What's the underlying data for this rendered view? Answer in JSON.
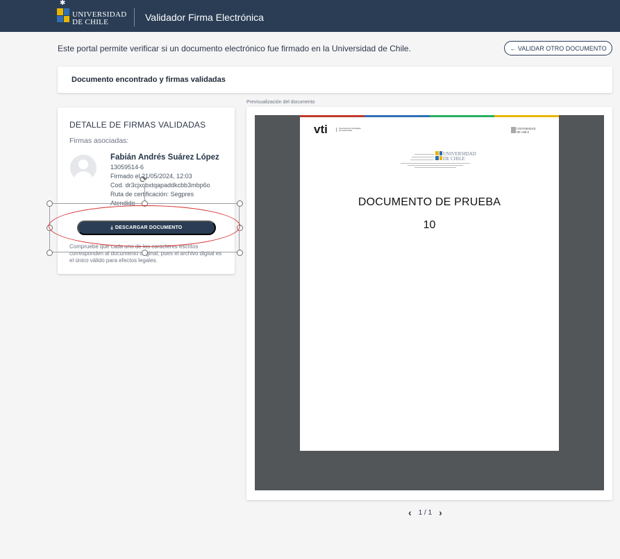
{
  "header": {
    "logo_text_line1": "UNIVERSIDAD",
    "logo_text_line2": "DE CHILE",
    "app_title": "Validador Firma Electrónica"
  },
  "intro_text": "Este portal permite verificar si un documento electrónico fue firmado en la Universidad de Chile.",
  "back_button_label": "← VALIDAR OTRO DOCUMENTO",
  "status_title": "Documento encontrado y firmas validadas",
  "detail": {
    "title": "DETALLE DE FIRMAS VALIDADAS",
    "assoc_label": "Firmas asociadas:",
    "signer": {
      "name": "Fabián Andrés Suárez López",
      "rut": "13059514-6",
      "signed_at": "Firmado el 21/05/2024, 12:03",
      "code": "Cod. dr3cjxcbxtqapaddkcbb3mbp6o",
      "cert_path": "Ruta de certificación: Segpres",
      "status": "Atendido"
    },
    "download_label": "DESCARGAR DOCUMENTO",
    "disclaimer": "Compruebe que cada uno de los caracteres escritos corresponden al documento original, pues el archivo digital es el único válido para efectos legales."
  },
  "preview": {
    "label": "Previsualización del documento",
    "page": {
      "vti_logo": "vti",
      "vti_sub": "Vicerrectoría de Tecnologías de la Información",
      "uchile_small_1": "UNIVERSIDAD",
      "uchile_small_2": "DE CHILE",
      "stamp_line1": "UNIVERSIDAD",
      "stamp_line2": "DE CHILE",
      "title": "DOCUMENTO DE PRUEBA",
      "number": "10"
    },
    "pager": "1 / 1"
  },
  "colors": {
    "header_bg": "#2a3d55",
    "accent": "#2a3d55",
    "annotation_red": "#d42b2b"
  }
}
